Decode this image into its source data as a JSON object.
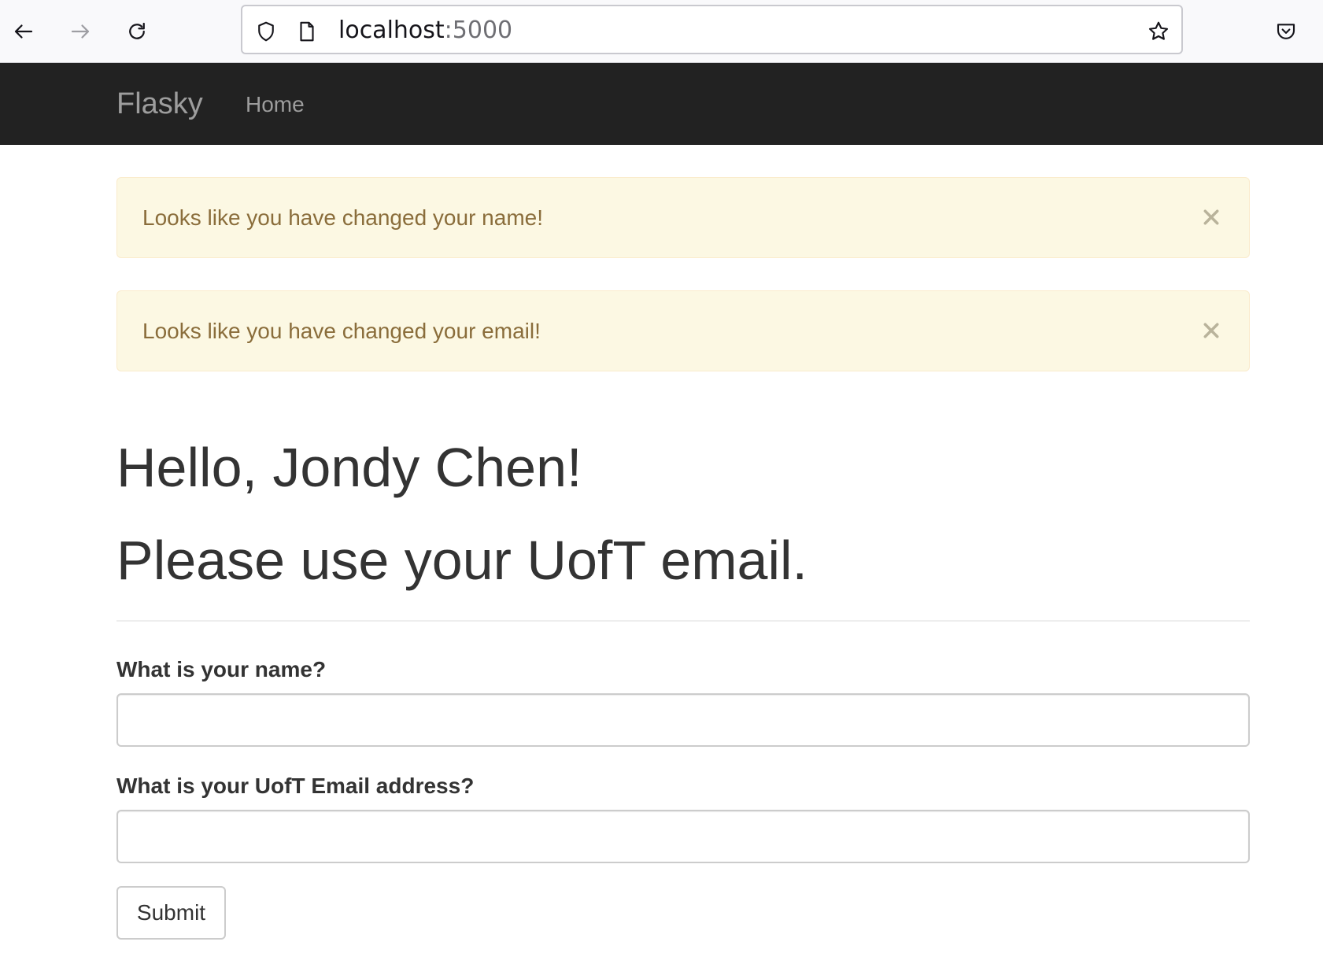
{
  "browser": {
    "url_host": "localhost",
    "url_port": ":5000"
  },
  "navbar": {
    "brand": "Flasky",
    "links": [
      {
        "label": "Home"
      }
    ]
  },
  "alerts": [
    {
      "message": "Looks like you have changed your name!",
      "close_glyph": "×"
    },
    {
      "message": "Looks like you have changed your email!",
      "close_glyph": "×"
    }
  ],
  "header": {
    "greeting": "Hello, Jondy Chen!",
    "subline": "Please use your UofT email."
  },
  "form": {
    "name_label": "What is your name?",
    "name_value": "",
    "email_label": "What is your UofT Email address?",
    "email_value": "",
    "submit_label": "Submit"
  },
  "colors": {
    "navbar_bg": "#222222",
    "alert_bg": "#fcf8e3",
    "alert_text": "#8a6d3b"
  },
  "icons": [
    "back-arrow-icon",
    "forward-arrow-icon",
    "reload-icon",
    "shield-icon",
    "page-icon",
    "bookmark-star-icon",
    "pocket-icon",
    "close-icon"
  ]
}
